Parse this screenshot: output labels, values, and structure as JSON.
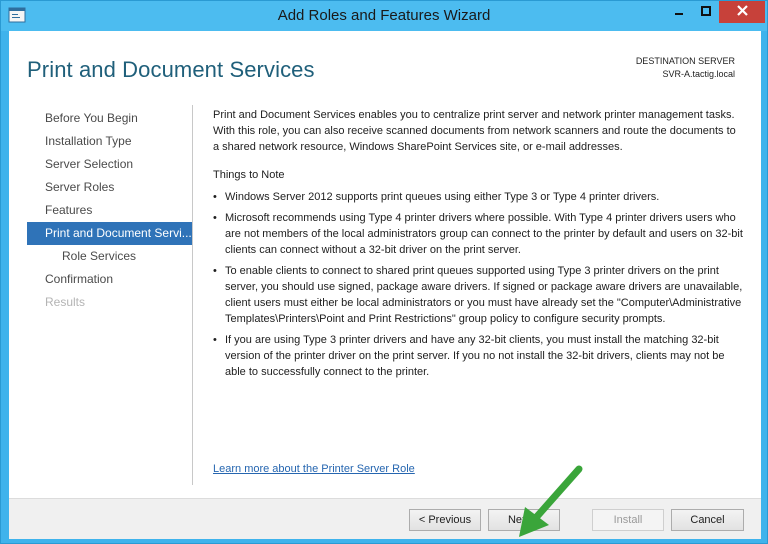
{
  "window": {
    "title": "Add Roles and Features Wizard"
  },
  "header": {
    "page_title": "Print and Document Services",
    "destination_label": "DESTINATION SERVER",
    "destination_value": "SVR-A.tactig.local"
  },
  "nav": {
    "items": [
      {
        "label": "Before You Begin",
        "state": "normal"
      },
      {
        "label": "Installation Type",
        "state": "normal"
      },
      {
        "label": "Server Selection",
        "state": "normal"
      },
      {
        "label": "Server Roles",
        "state": "normal"
      },
      {
        "label": "Features",
        "state": "normal"
      },
      {
        "label": "Print and Document Servi...",
        "state": "active"
      },
      {
        "label": "Role Services",
        "state": "sub"
      },
      {
        "label": "Confirmation",
        "state": "normal"
      },
      {
        "label": "Results",
        "state": "disabled"
      }
    ]
  },
  "content": {
    "intro": "Print and Document Services enables you to centralize print server and network printer management tasks. With this role, you can also receive scanned documents from network scanners and route the documents to a shared network resource, Windows SharePoint Services site, or e-mail addresses.",
    "notes_heading": "Things to Note",
    "bullets": [
      "Windows Server 2012 supports print queues using either Type 3 or Type 4 printer drivers.",
      "Microsoft recommends using Type 4 printer drivers where possible. With Type 4 printer drivers users who are not members of the local administrators group can connect to the printer by default and users on 32-bit clients can connect without a 32-bit driver on the print server.",
      "To enable clients to connect to shared print queues supported using Type 3 printer drivers on the print server, you should use signed, package aware drivers. If signed or package aware drivers are unavailable, client users must either be local administrators or you must have already set the \"Computer\\Administrative Templates\\Printers\\Point and Print Restrictions\" group policy to configure security prompts.",
      "If you are using Type 3 printer drivers and have any 32-bit clients, you must install the matching 32-bit version of the printer driver on the print server. If you no not install the 32-bit drivers, clients may not be able to successfully connect to the printer."
    ],
    "learn_more": "Learn more about the Printer Server Role"
  },
  "footer": {
    "previous_label": "< Previous",
    "next_label": "Next >",
    "install_label": "Install",
    "cancel_label": "Cancel"
  },
  "colors": {
    "title_bar": "#4cbcf0",
    "active_nav": "#2f73b8",
    "page_title": "#1f5f7a",
    "link": "#2666b0",
    "annotation_arrow": "#3aa53a",
    "close_button": "#c7413a"
  },
  "icons": {
    "app": "server-manager-icon",
    "minimize": "minimize-icon",
    "maximize": "maximize-icon",
    "close": "close-icon",
    "annotation": "green-arrow-pointer"
  }
}
